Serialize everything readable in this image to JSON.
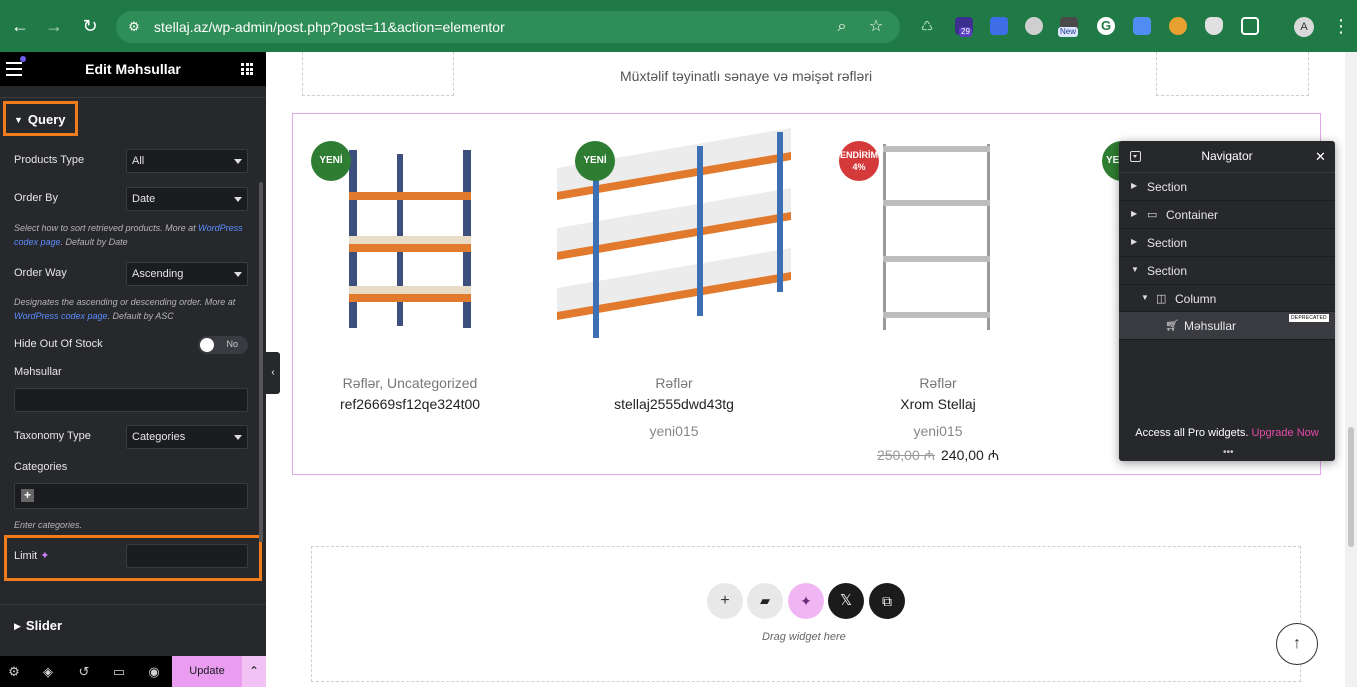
{
  "browser": {
    "url": "stellaj.az/wp-admin/post.php?post=11&action=elementor",
    "extension_badge": "29",
    "extension_new": "New",
    "profile_initial": "A"
  },
  "panel": {
    "title": "Edit Məhsullar",
    "query_section": "Query",
    "products_type_label": "Products Type",
    "products_type_value": "All",
    "order_by_label": "Order By",
    "order_by_value": "Date",
    "order_by_help_1": "Select how to sort retrieved products. More at ",
    "order_by_help_link": "WordPress codex page",
    "order_by_help_2": ". Default by Date",
    "order_way_label": "Order Way",
    "order_way_value": "Ascending",
    "order_way_help_1": "Designates the ascending or descending order. More at ",
    "order_way_help_link": "WordPress codex page",
    "order_way_help_2": ". Default by ASC",
    "hide_out_of_stock_label": "Hide Out Of Stock",
    "hide_out_of_stock_value": "No",
    "mehsullar_label": "Məhsullar",
    "taxonomy_type_label": "Taxonomy Type",
    "taxonomy_type_value": "Categories",
    "categories_label": "Categories",
    "categories_help": "Enter categories.",
    "limit_label": "Limit",
    "slider_section": "Slider",
    "update_label": "Update"
  },
  "canvas": {
    "subtitle": "Müxtəlif təyinatlı sənaye və məişət rəfləri",
    "drag_text": "Drag widget here",
    "products": [
      {
        "badge": "YENİ",
        "category": "Rəflər, Uncategorized",
        "name": "ref26669sf12qe324t00",
        "sku": "",
        "old_price": "",
        "price": ""
      },
      {
        "badge": "YENİ",
        "category": "Rəflər",
        "name": "stellaj2555dwd43tg",
        "sku": "yeni015",
        "old_price": "",
        "price": ""
      },
      {
        "badge": "ENDİRİM",
        "badge_sub": "4%",
        "category": "Rəflər",
        "name": "Xrom Stellaj",
        "sku": "yeni015",
        "old_price": "250,00 ₼",
        "price": "240,00 ₼"
      },
      {
        "badge": "YE"
      }
    ]
  },
  "navigator": {
    "title": "Navigator",
    "items": [
      {
        "label": "Section"
      },
      {
        "label": "Container"
      },
      {
        "label": "Section"
      },
      {
        "label": "Section"
      },
      {
        "label": "Column"
      },
      {
        "label": "Məhsullar"
      }
    ],
    "deprecated_tag": "DEPRECATED",
    "pro_text": "Access all Pro widgets.",
    "pro_link": "Upgrade Now"
  },
  "colors": {
    "chrome": "#1f7a46",
    "panel": "#27282c",
    "highlight": "#f07b1d",
    "accent_pink": "#e99cf0",
    "badge_green": "#2e7d32",
    "badge_red": "#d53a3a"
  }
}
